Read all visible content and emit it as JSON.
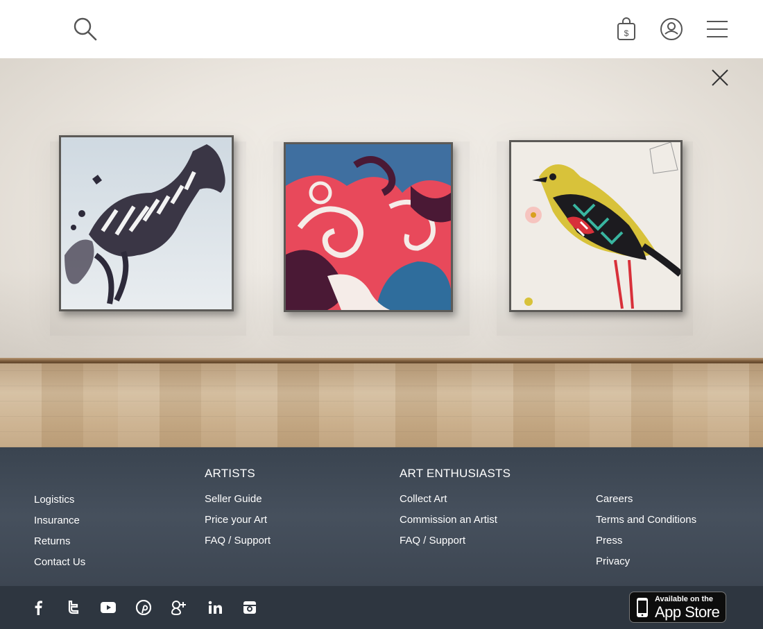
{
  "header": {
    "icons": [
      "search-icon",
      "shopping-bag-icon",
      "user-icon",
      "menu-icon"
    ],
    "bag_symbol": "$"
  },
  "gallery": {
    "close_icon": "close-icon",
    "artworks": [
      {
        "subject": "zebra",
        "colors": [
          "#dde4ea",
          "#2d2a3a",
          "#f2f2f2"
        ]
      },
      {
        "subject": "abstract swirls",
        "colors": [
          "#e8495b",
          "#2f6d9c",
          "#4a1935",
          "#f5ece8"
        ]
      },
      {
        "subject": "bird",
        "colors": [
          "#f0ece6",
          "#d8c23a",
          "#1c1b1f",
          "#d8303a"
        ]
      }
    ]
  },
  "footer": {
    "columns": [
      {
        "heading": "",
        "links": [
          "Logistics",
          "Insurance",
          "Returns",
          "Contact Us"
        ]
      },
      {
        "heading": "ARTISTS",
        "links": [
          "Seller Guide",
          "Price your Art",
          "FAQ / Support"
        ]
      },
      {
        "heading": "ART ENTHUSIASTS",
        "links": [
          "Collect Art",
          "Commission an Artist",
          "FAQ / Support"
        ]
      },
      {
        "heading": "",
        "links": [
          "Careers",
          "Terms and Conditions",
          "Press",
          "Privacy"
        ]
      }
    ],
    "social": [
      "facebook-icon",
      "twitter-icon",
      "youtube-icon",
      "pinterest-icon",
      "google-plus-icon",
      "linkedin-icon",
      "instagram-icon"
    ],
    "appstore": {
      "line1": "Available on the",
      "line2": "App Store"
    }
  }
}
